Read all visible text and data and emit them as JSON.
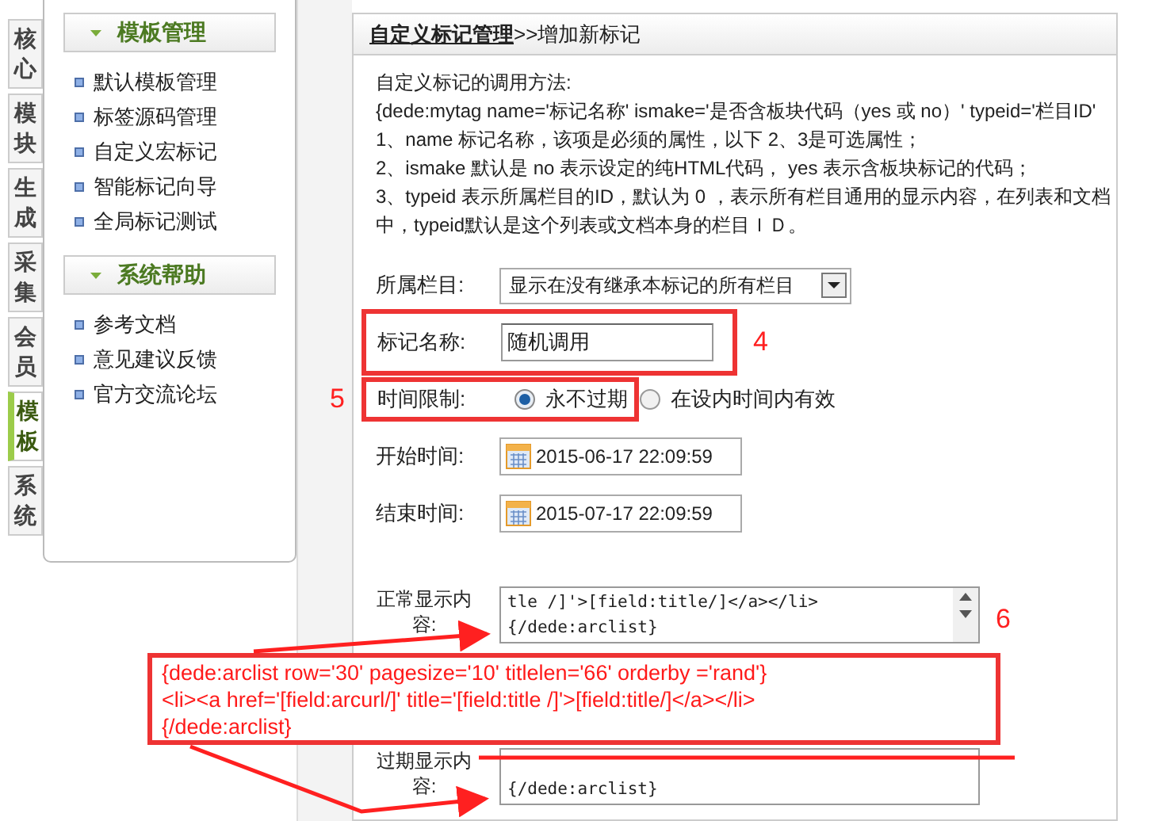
{
  "left_tabs": [
    {
      "label": "核心",
      "selected": false
    },
    {
      "label": "模块",
      "selected": false
    },
    {
      "label": "生成",
      "selected": false
    },
    {
      "label": "采集",
      "selected": false
    },
    {
      "label": "会员",
      "selected": false
    },
    {
      "label": "模板",
      "selected": true
    },
    {
      "label": "系统",
      "selected": false
    }
  ],
  "sidebar": {
    "sections": [
      {
        "title": "模板管理",
        "items": [
          "默认模板管理",
          "标签源码管理",
          "自定义宏标记",
          "智能标记向导",
          "全局标记测试"
        ]
      },
      {
        "title": "系统帮助",
        "items": [
          "参考文档",
          "意见建议反馈",
          "官方交流论坛"
        ]
      }
    ]
  },
  "main": {
    "breadcrumb": {
      "link": "自定义标记管理",
      "current": ">>增加新标记"
    },
    "help_lines": [
      "自定义标记的调用方法:",
      "{dede:mytag name='标记名称' ismake='是否含板块代码（yes 或 no）' typeid='栏目ID'",
      "1、name 标记名称，该项是必须的属性，以下 2、3是可选属性；",
      "2、ismake 默认是 no 表示设定的纯HTML代码， yes 表示含板块标记的代码；",
      "3、typeid 表示所属栏目的ID，默认为 0 ，表示所有栏目通用的显示内容，在列表和文档",
      "中，typeid默认是这个列表或文档本身的栏目ＩＤ。"
    ],
    "form": [
      {
        "kind": "select",
        "label": "所属栏目:",
        "value": "显示在没有继承本标记的所有栏目"
      },
      {
        "kind": "text",
        "label": "标记名称:",
        "value": "随机调用",
        "marker": {
          "kind": "boxed-right",
          "label": "4"
        }
      },
      {
        "kind": "radio",
        "label": "时间限制:",
        "options": [
          {
            "label": "永不过期",
            "selected": true
          },
          {
            "label": "在设内时间内有效",
            "selected": false
          }
        ],
        "marker": {
          "kind": "boxed-left",
          "label": "5"
        }
      },
      {
        "kind": "date",
        "label": "开始时间:",
        "value": "2015-06-17 22:09:59"
      },
      {
        "kind": "date",
        "label": "结束时间:",
        "value": "2015-07-17 22:09:59"
      },
      {
        "kind": "textarea",
        "label": "正常显示内容:",
        "lines": [
          "tle /]'>[field:title/]</a></li>",
          "{/dede:arclist}"
        ],
        "marker": {
          "kind": "plain-right",
          "label": "6"
        }
      },
      {
        "kind": "textarea",
        "label": "过期显示内容:",
        "lines": [
          "{/dede:arclist}"
        ]
      }
    ]
  },
  "annotation": {
    "code_lines": [
      "{dede:arclist row='30' pagesize='10' titlelen='66' orderby ='rand'}",
      "<li><a href='[field:arcurl/]' title='[field:title /]'>[field:title/]</a></li>",
      "{/dede:arclist}"
    ]
  }
}
